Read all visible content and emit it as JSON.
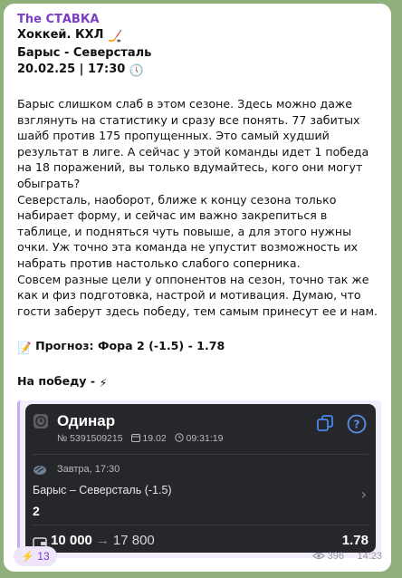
{
  "post": {
    "channel_name": "The СТАВКА",
    "line1": "Хоккей. КХЛ",
    "line1_emoji": "🏒",
    "line2": "Барыс - Северсталь",
    "line3": "20.02.25 | 17:30",
    "line3_emoji": "🕔",
    "paragraphs": [
      "Барыс слишком слаб в этом сезоне. Здесь можно даже взглянуть на статистику и сразу все понять. 77 забитых шайб против 175 пропущенных. Это самый худший результат в лиге. А сейчас у этой команды идет 1 победа на 18 поражений, вы только вдумайтесь, кого они могут обыграть?",
      "Северсталь, наоборот, ближе к концу сезона только набирает форму, и сейчас им важно закрепиться в таблице, и подняться чуть повыше, а для этого нужны очки. Уж точно эта команда не упустит возможность их набрать против настолько слабого соперника.",
      "Совсем разные цели у оппонентов на сезон, точно так же как и физ подготовка, настрой и мотивация. Думаю, что гости заберут здесь победу, тем самым принесут ее и нам."
    ],
    "forecast_emoji": "📝",
    "forecast": "Прогноз: Фора 2 (-1.5) - 1.78",
    "win_label": "На победу -",
    "win_emoji": "⚡"
  },
  "bet_card": {
    "title": "Одинар",
    "number": "№ 5391509215",
    "date": "19.02",
    "time": "09:31:19",
    "event_date": "Завтра, 17:30",
    "event_name": "Барыс – Северсталь (-1.5)",
    "bet_value": "2",
    "stake": "10 000",
    "arrow": "→",
    "payout": "17 800",
    "coefficient": "1.78",
    "icons": [
      "clock-icon",
      "calendar-icon",
      "copy-icon",
      "help-icon",
      "puck-icon",
      "chevron-right-icon",
      "wallet-icon"
    ]
  },
  "footer": {
    "reaction_emoji": "⚡",
    "reaction_count": "13",
    "views": "396",
    "time": "14:23"
  },
  "colors": {
    "accent": "#7b3fc4",
    "card_bg": "#26272b",
    "help_circle": "#5a8dee",
    "copy_icon": "#4a86f0"
  }
}
